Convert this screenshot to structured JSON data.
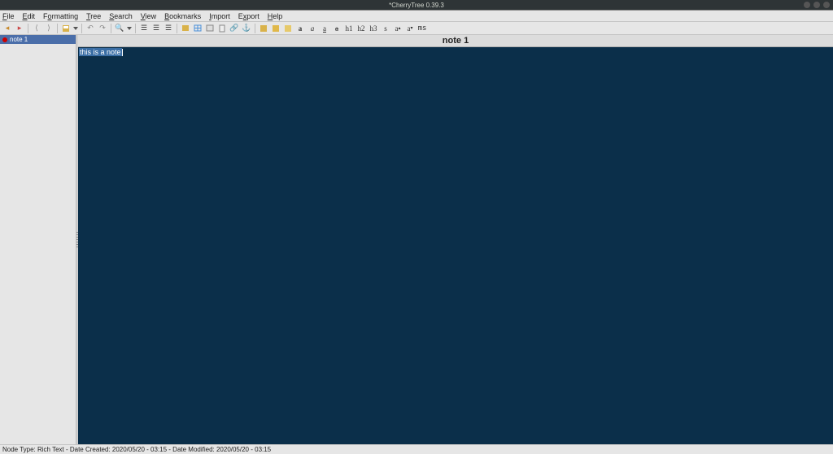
{
  "window": {
    "title": "*CherryTree 0.39.3"
  },
  "menu": {
    "file": "File",
    "edit": "Edit",
    "formatting": "Formatting",
    "tree": "Tree",
    "search": "Search",
    "view": "View",
    "bookmarks": "Bookmarks",
    "import": "Import",
    "export": "Export",
    "help": "Help"
  },
  "tree": {
    "items": [
      {
        "label": "note 1"
      }
    ]
  },
  "node": {
    "title": "note 1"
  },
  "editor": {
    "content": "this is a note"
  },
  "status": {
    "text": "Node Type: Rich Text  -  Date Created: 2020/05/20 - 03:15  -  Date Modified: 2020/05/20 - 03:15"
  },
  "format": {
    "bold": "a",
    "italic": "a",
    "underline": "a",
    "strike": "a",
    "h1": "h1",
    "h2": "h2",
    "h3": "h3",
    "small": "s",
    "sup": "a",
    "sub": "a",
    "mono": "ms",
    "fg": "-"
  }
}
